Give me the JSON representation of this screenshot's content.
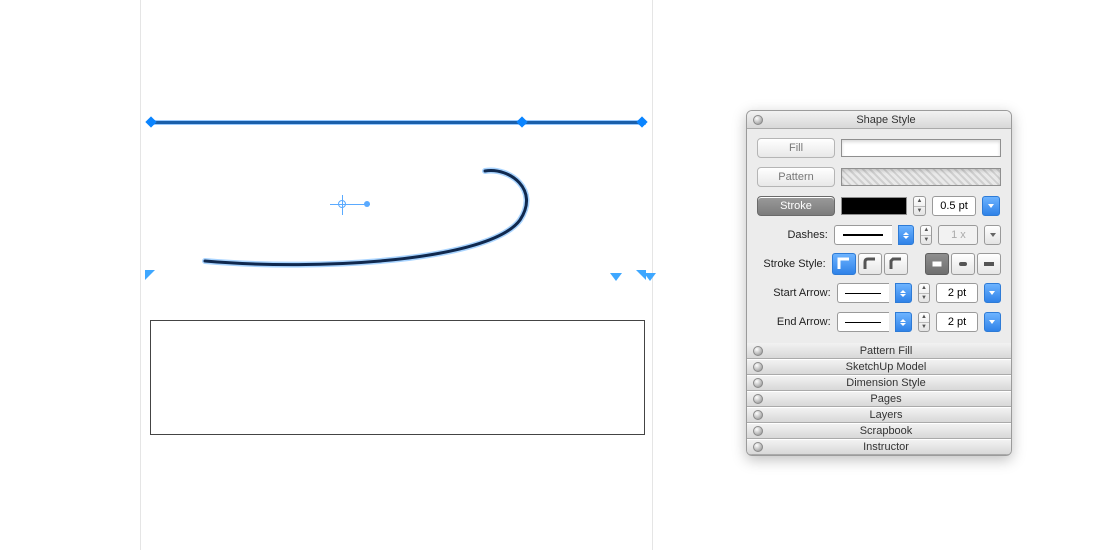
{
  "panel": {
    "title": "Shape Style",
    "fill_label": "Fill",
    "pattern_label": "Pattern",
    "stroke_label": "Stroke",
    "stroke_width": "0.5 pt",
    "dashes_label": "Dashes:",
    "dashes_mult": "1 x",
    "stroke_style_label": "Stroke Style:",
    "start_arrow_label": "Start Arrow:",
    "start_arrow_size": "2 pt",
    "end_arrow_label": "End Arrow:",
    "end_arrow_size": "2 pt"
  },
  "collapsed": [
    "Pattern Fill",
    "SketchUp Model",
    "Dimension Style",
    "Pages",
    "Layers",
    "Scrapbook",
    "Instructor"
  ]
}
